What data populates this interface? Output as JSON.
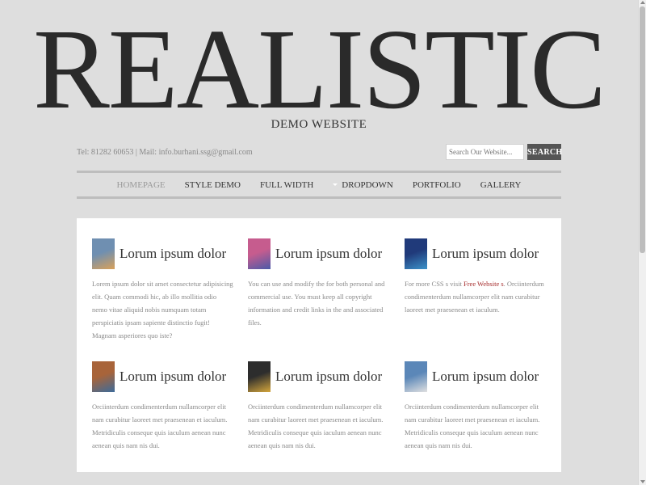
{
  "header": {
    "logo": "REALISTIC",
    "tagline": "DEMO WEBSITE",
    "contact": "Tel: 81282 60653 | Mail: info.burhani.ssg@gmail.com"
  },
  "search": {
    "placeholder": "Search Our Website...",
    "button_label": "SEARCH"
  },
  "nav": {
    "items": [
      {
        "label": "HOMEPAGE",
        "active": true
      },
      {
        "label": "STYLE DEMO"
      },
      {
        "label": "FULL WIDTH"
      },
      {
        "label": "DROPDOWN"
      },
      {
        "label": "PORTFOLIO"
      },
      {
        "label": "GALLERY"
      }
    ]
  },
  "cards": [
    {
      "title": "Lorum ipsum dolor",
      "text": "Lorem ipsum dolor sit amet consectetur adipisicing elit. Quam commodi hic, ab illo mollitia odio nemo vitae aliquid nobis numquam totam perspiciatis ipsam sapiente distinctio fugit! Magnam asperiores quo iste?",
      "colors": [
        "#6f8fb1",
        "#d9a15a"
      ]
    },
    {
      "title": "Lorum ipsum dolor",
      "text": "You can use and modify the for both personal and commercial use. You must keep all copyright information and credit links in the and associated files.",
      "colors": [
        "#c65c8e",
        "#4b5aa8"
      ]
    },
    {
      "title": "Lorum ipsum dolor",
      "text_before": "For more CSS s visit ",
      "link": "Free Website s",
      "text_after": ". Orciinterdum condimenterdum nullamcorper elit nam curabitur laoreet met praesenean et iaculum.",
      "colors": [
        "#203a7a",
        "#3b92c9"
      ]
    },
    {
      "title": "Lorum ipsum dolor",
      "text": "Orciinterdum condimenterdum nullamcorper elit nam curabitur laoreet met praesenean et iaculum. Metridiculis conseque quis iaculum aenean nunc aenean quis nam nis dui.",
      "colors": [
        "#a8643a",
        "#3d6b9a"
      ]
    },
    {
      "title": "Lorum ipsum dolor",
      "text": "Orciinterdum condimenterdum nullamcorper elit nam curabitur laoreet met praesenean et iaculum. Metridiculis conseque quis iaculum aenean nunc aenean quis nam nis dui.",
      "colors": [
        "#2d2d2d",
        "#d4a63c"
      ]
    },
    {
      "title": "Lorum ipsum dolor",
      "text": "Orciinterdum condimenterdum nullamcorper elit nam curabitur laoreet met praesenean et iaculum. Metridiculis conseque quis iaculum aenean nunc aenean quis nam nis dui.",
      "colors": [
        "#5b87b8",
        "#e0e0e0"
      ]
    }
  ]
}
